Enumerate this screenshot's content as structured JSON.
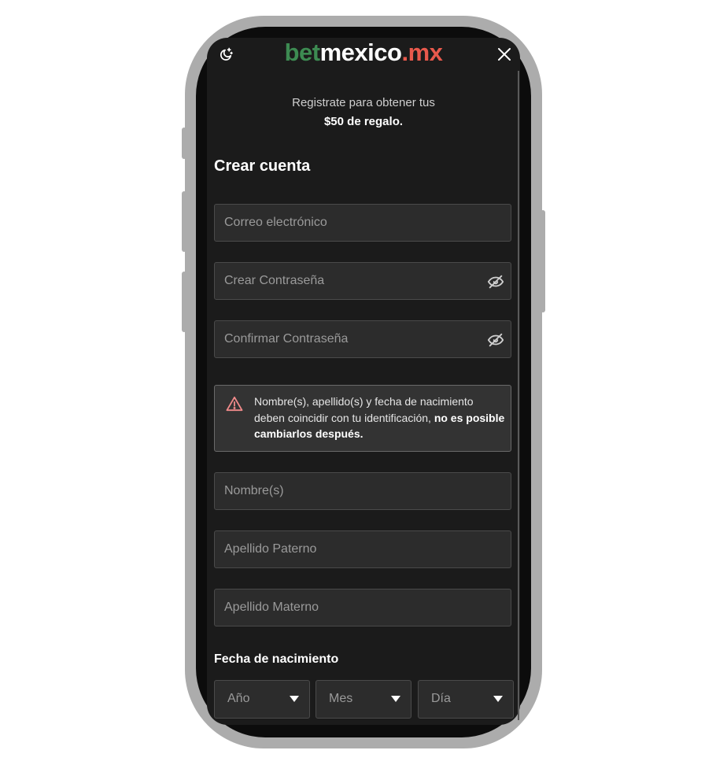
{
  "header": {
    "logo": {
      "part1": "bet",
      "part2": "mexico",
      "part3": ".mx"
    },
    "theme_toggle_icon": "moon-stars-icon",
    "close_icon": "close-icon"
  },
  "promo": {
    "line1": "Registrate para obtener tus",
    "line2": "$50 de regalo."
  },
  "form": {
    "title": "Crear cuenta",
    "email": {
      "placeholder": "Correo electrónico",
      "value": ""
    },
    "password": {
      "placeholder": "Crear Contraseña",
      "value": "",
      "toggle_icon": "eye-off-icon"
    },
    "confirm_password": {
      "placeholder": "Confirmar Contraseña",
      "value": "",
      "toggle_icon": "eye-off-icon"
    },
    "notice": {
      "icon": "warning-icon",
      "text": "Nombre(s), apellido(s) y fecha de nacimiento deben coincidir con tu identificación, ",
      "bold": "no es posible cambiarlos después."
    },
    "first_name": {
      "placeholder": "Nombre(s)",
      "value": ""
    },
    "last_name_paternal": {
      "placeholder": "Apellido Paterno",
      "value": ""
    },
    "last_name_maternal": {
      "placeholder": "Apellido Materno",
      "value": ""
    },
    "dob": {
      "label": "Fecha de nacimiento",
      "year": "Año",
      "month": "Mes",
      "day": "Día"
    }
  },
  "colors": {
    "background": "#1b1b1b",
    "input_bg": "#2c2c2c",
    "logo_green": "#3d8b52",
    "logo_red": "#e8594c",
    "warning_icon": "#f08a8a"
  }
}
